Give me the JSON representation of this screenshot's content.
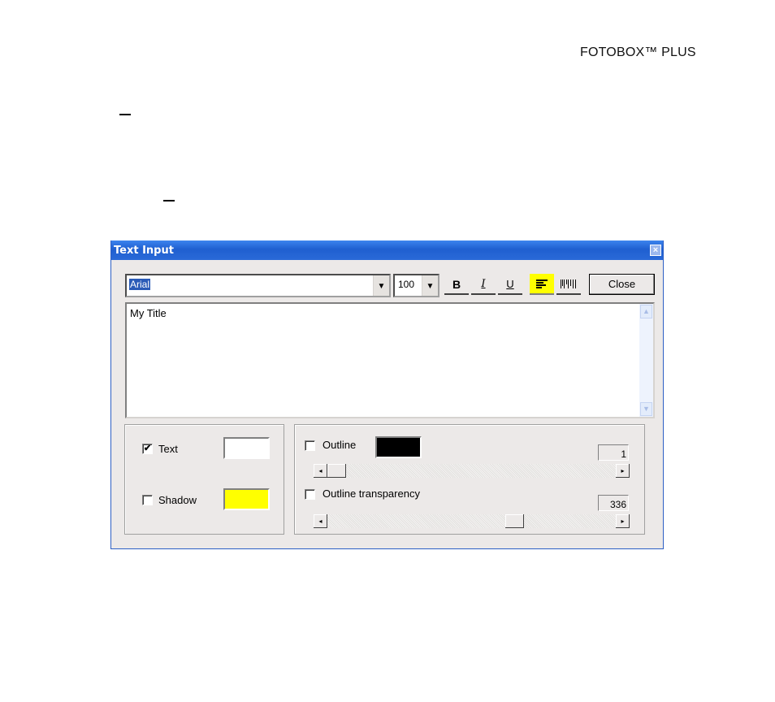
{
  "page": {
    "brand": "FOTOBOX™ PLUS"
  },
  "dialog": {
    "title": "Text Input",
    "close_icon": "×",
    "toolbar": {
      "font_value": "Arial",
      "size_value": "100",
      "dropdown_icon": "▼",
      "bold_label": "B",
      "italic_label": "I",
      "underline_label": "U",
      "align_left_icon": "align-left",
      "justify_icon": "justify",
      "align_left_active": true,
      "close_label": "Close"
    },
    "text_value": "My Title",
    "scroll_up_icon": "▲",
    "scroll_down_icon": "▼",
    "fill_group": {
      "text": {
        "label": "Text",
        "checked": true,
        "check_glyph": "✔",
        "color": "#ffffff"
      },
      "shadow": {
        "label": "Shadow",
        "checked": false,
        "color": "#ffff00"
      }
    },
    "outline_group": {
      "outline": {
        "label": "Outline",
        "checked": false,
        "color": "#000000",
        "value": "1",
        "slider_fraction": 0.0
      },
      "transparency": {
        "label": "Outline transparency",
        "checked": false,
        "value": "336",
        "slider_fraction": 0.66
      },
      "left_arrow": "◂",
      "right_arrow": "▸"
    }
  }
}
